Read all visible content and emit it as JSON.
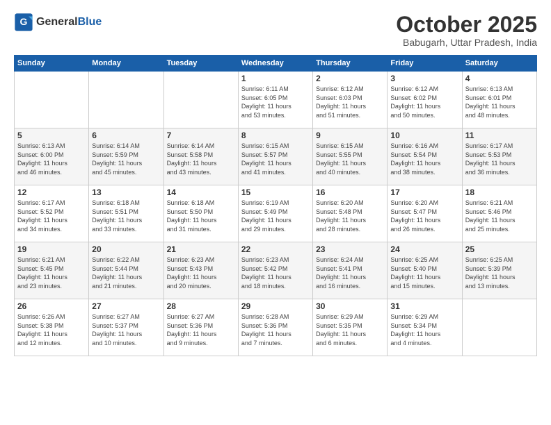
{
  "header": {
    "logo_general": "General",
    "logo_blue": "Blue",
    "month_title": "October 2025",
    "location": "Babugarh, Uttar Pradesh, India"
  },
  "weekdays": [
    "Sunday",
    "Monday",
    "Tuesday",
    "Wednesday",
    "Thursday",
    "Friday",
    "Saturday"
  ],
  "weeks": [
    [
      {
        "day": "",
        "info": ""
      },
      {
        "day": "",
        "info": ""
      },
      {
        "day": "",
        "info": ""
      },
      {
        "day": "1",
        "info": "Sunrise: 6:11 AM\nSunset: 6:05 PM\nDaylight: 11 hours\nand 53 minutes."
      },
      {
        "day": "2",
        "info": "Sunrise: 6:12 AM\nSunset: 6:03 PM\nDaylight: 11 hours\nand 51 minutes."
      },
      {
        "day": "3",
        "info": "Sunrise: 6:12 AM\nSunset: 6:02 PM\nDaylight: 11 hours\nand 50 minutes."
      },
      {
        "day": "4",
        "info": "Sunrise: 6:13 AM\nSunset: 6:01 PM\nDaylight: 11 hours\nand 48 minutes."
      }
    ],
    [
      {
        "day": "5",
        "info": "Sunrise: 6:13 AM\nSunset: 6:00 PM\nDaylight: 11 hours\nand 46 minutes."
      },
      {
        "day": "6",
        "info": "Sunrise: 6:14 AM\nSunset: 5:59 PM\nDaylight: 11 hours\nand 45 minutes."
      },
      {
        "day": "7",
        "info": "Sunrise: 6:14 AM\nSunset: 5:58 PM\nDaylight: 11 hours\nand 43 minutes."
      },
      {
        "day": "8",
        "info": "Sunrise: 6:15 AM\nSunset: 5:57 PM\nDaylight: 11 hours\nand 41 minutes."
      },
      {
        "day": "9",
        "info": "Sunrise: 6:15 AM\nSunset: 5:55 PM\nDaylight: 11 hours\nand 40 minutes."
      },
      {
        "day": "10",
        "info": "Sunrise: 6:16 AM\nSunset: 5:54 PM\nDaylight: 11 hours\nand 38 minutes."
      },
      {
        "day": "11",
        "info": "Sunrise: 6:17 AM\nSunset: 5:53 PM\nDaylight: 11 hours\nand 36 minutes."
      }
    ],
    [
      {
        "day": "12",
        "info": "Sunrise: 6:17 AM\nSunset: 5:52 PM\nDaylight: 11 hours\nand 34 minutes."
      },
      {
        "day": "13",
        "info": "Sunrise: 6:18 AM\nSunset: 5:51 PM\nDaylight: 11 hours\nand 33 minutes."
      },
      {
        "day": "14",
        "info": "Sunrise: 6:18 AM\nSunset: 5:50 PM\nDaylight: 11 hours\nand 31 minutes."
      },
      {
        "day": "15",
        "info": "Sunrise: 6:19 AM\nSunset: 5:49 PM\nDaylight: 11 hours\nand 29 minutes."
      },
      {
        "day": "16",
        "info": "Sunrise: 6:20 AM\nSunset: 5:48 PM\nDaylight: 11 hours\nand 28 minutes."
      },
      {
        "day": "17",
        "info": "Sunrise: 6:20 AM\nSunset: 5:47 PM\nDaylight: 11 hours\nand 26 minutes."
      },
      {
        "day": "18",
        "info": "Sunrise: 6:21 AM\nSunset: 5:46 PM\nDaylight: 11 hours\nand 25 minutes."
      }
    ],
    [
      {
        "day": "19",
        "info": "Sunrise: 6:21 AM\nSunset: 5:45 PM\nDaylight: 11 hours\nand 23 minutes."
      },
      {
        "day": "20",
        "info": "Sunrise: 6:22 AM\nSunset: 5:44 PM\nDaylight: 11 hours\nand 21 minutes."
      },
      {
        "day": "21",
        "info": "Sunrise: 6:23 AM\nSunset: 5:43 PM\nDaylight: 11 hours\nand 20 minutes."
      },
      {
        "day": "22",
        "info": "Sunrise: 6:23 AM\nSunset: 5:42 PM\nDaylight: 11 hours\nand 18 minutes."
      },
      {
        "day": "23",
        "info": "Sunrise: 6:24 AM\nSunset: 5:41 PM\nDaylight: 11 hours\nand 16 minutes."
      },
      {
        "day": "24",
        "info": "Sunrise: 6:25 AM\nSunset: 5:40 PM\nDaylight: 11 hours\nand 15 minutes."
      },
      {
        "day": "25",
        "info": "Sunrise: 6:25 AM\nSunset: 5:39 PM\nDaylight: 11 hours\nand 13 minutes."
      }
    ],
    [
      {
        "day": "26",
        "info": "Sunrise: 6:26 AM\nSunset: 5:38 PM\nDaylight: 11 hours\nand 12 minutes."
      },
      {
        "day": "27",
        "info": "Sunrise: 6:27 AM\nSunset: 5:37 PM\nDaylight: 11 hours\nand 10 minutes."
      },
      {
        "day": "28",
        "info": "Sunrise: 6:27 AM\nSunset: 5:36 PM\nDaylight: 11 hours\nand 9 minutes."
      },
      {
        "day": "29",
        "info": "Sunrise: 6:28 AM\nSunset: 5:36 PM\nDaylight: 11 hours\nand 7 minutes."
      },
      {
        "day": "30",
        "info": "Sunrise: 6:29 AM\nSunset: 5:35 PM\nDaylight: 11 hours\nand 6 minutes."
      },
      {
        "day": "31",
        "info": "Sunrise: 6:29 AM\nSunset: 5:34 PM\nDaylight: 11 hours\nand 4 minutes."
      },
      {
        "day": "",
        "info": ""
      }
    ]
  ]
}
